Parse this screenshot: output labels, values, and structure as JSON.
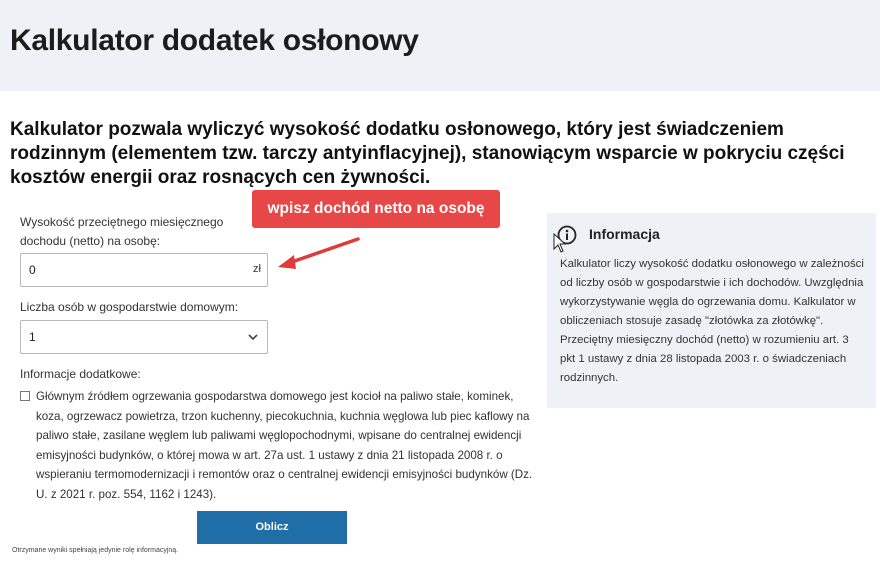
{
  "header": {
    "title": "Kalkulator dodatek osłonowy"
  },
  "intro": "Kalkulator pozwala wyliczyć wysokość dodatku osłonowego, który jest świadczeniem rodzinnym (elementem tzw. tarczy antyinflacyjnej), stanowiącym wsparcie w pokryciu części kosztów energii oraz rosnących cen żywności.",
  "form": {
    "income_label_line1": "Wysokość przeciętnego miesięcznego",
    "income_label_line2": "dochodu (netto) na osobę:",
    "income_value": "0",
    "income_unit": "zł",
    "persons_label": "Liczba osób w gospodarstwie domowym:",
    "persons_value": "1",
    "extra_label": "Informacje dodatkowe:",
    "checkbox_text": "Głównym źródłem ogrzewania gospodarstwa domowego jest kocioł na paliwo stałe, kominek, koza, ogrzewacz powietrza, trzon kuchenny, piecokuchnia, kuchnia węglowa lub piec kaflowy na paliwo stałe, zasilane węglem lub paliwami węglopochodnymi, wpisane do centralnej ewidencji emisyjności budynków, o której mowa w art. 27a ust. 1 ustawy z dnia 21 listopada 2008 r. o wspieraniu termomodernizacji i remontów oraz o centralnej ewidencji emisyjności budynków (Dz. U. z 2021 r. poz. 554, 1162 i 1243).",
    "checkbox_checked": false,
    "submit_label": "Oblicz"
  },
  "disclaimer": "Otrzymane wyniki spełniają jedynie rolę informacyjną.",
  "callout": "wpisz dochód netto na osobę",
  "info": {
    "title": "Informacja",
    "text_part1": "Kalkulator liczy wysokość dodatku osłonowego w zależności od liczby osób w gospodarstwie i ich dochodów. Uwzględnia wykorzystywanie węgla do ogrzewania domu. Kalkulator w obliczeniach stosuje zasadę \"złotówka za złotówkę\".",
    "text_part2": "Przeciętny miesięczny dochód (netto) w rozumieniu art. 3 pkt 1 ustawy z dnia 28 listopada 2003 r. o świadczeniach rodzinnych."
  },
  "icons": {
    "info": "info-circle-icon",
    "dropdown": "chevron-down-icon",
    "arrow": "red-arrow-icon",
    "cursor": "mouse-pointer-icon"
  },
  "colors": {
    "header_bg": "#eef2f6",
    "button": "#1f6ea7",
    "callout": "#e74747"
  }
}
